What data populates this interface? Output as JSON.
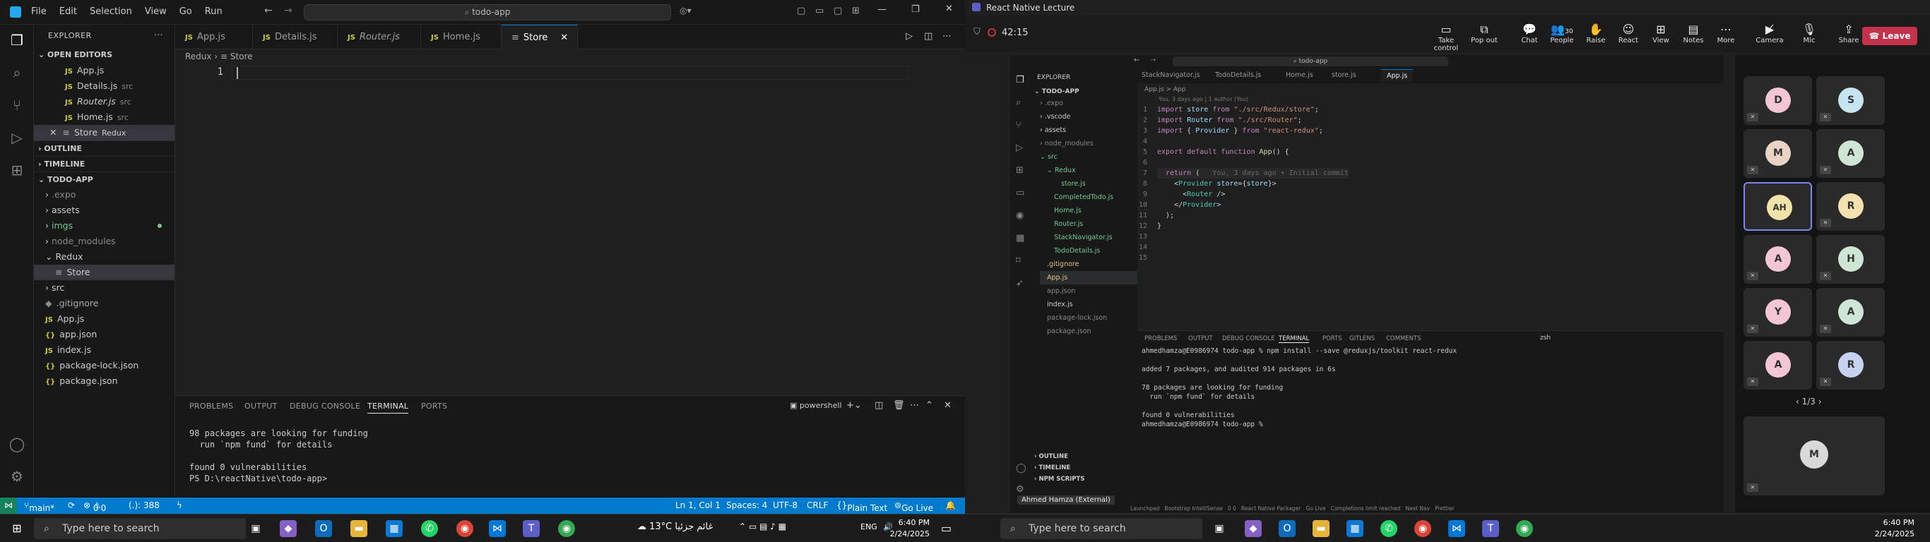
{
  "left": {
    "menu": [
      "File",
      "Edit",
      "Selection",
      "View",
      "Go",
      "Run"
    ],
    "command_center": "todo-app",
    "explorer_title": "EXPLORER",
    "open_editors_label": "OPEN EDITORS",
    "open_editors": [
      {
        "name": "App.js",
        "sub": ""
      },
      {
        "name": "Details.js",
        "sub": "src"
      },
      {
        "name": "Router.js",
        "sub": "src"
      },
      {
        "name": "Home.js",
        "sub": "src"
      },
      {
        "name": "Store",
        "sub": "Redux"
      }
    ],
    "outline_label": "OUTLINE",
    "timeline_label": "TIMELINE",
    "project_label": "TODO-APP",
    "tree": [
      ".expo",
      "assets",
      "imgs",
      "node_modules",
      "Redux",
      "Store",
      "src",
      ".gitignore",
      "App.js",
      "app.json",
      "index.js",
      "package-lock.json",
      "package.json"
    ],
    "tabs": [
      "App.js",
      "Details.js",
      "Router.js",
      "Home.js",
      "Store"
    ],
    "breadcrumb": [
      "Redux",
      "Store"
    ],
    "line_number": "1",
    "panel_tabs": [
      "PROBLEMS",
      "OUTPUT",
      "DEBUG CONSOLE",
      "TERMINAL",
      "PORTS"
    ],
    "shell": "powershell",
    "terminal_text": "98 packages are looking for funding\n  run `npm fund` for details\n\nfound 0 vulnerabilities\nPS D:\\reactNative\\todo-app> ",
    "status": {
      "branch": "main*",
      "errors": "0",
      "warnings": "0",
      "extra": "(.): 388",
      "position": "Ln 1, Col 1",
      "spaces": "Spaces: 4",
      "encoding": "UTF-8",
      "eol": "CRLF",
      "language": "Plain Text",
      "golive": "Go Live"
    }
  },
  "teams": {
    "window_title": "React Native Lecture",
    "timer": "42:15",
    "buttons": [
      "Take control",
      "Pop out",
      "Chat",
      "People",
      "Raise",
      "React",
      "View",
      "Notes",
      "More",
      "Camera",
      "Mic",
      "Share"
    ],
    "people_count": "30",
    "leave_label": "Leave",
    "participants": [
      "D",
      "S",
      "M",
      "A",
      "AH",
      "R",
      "A",
      "H",
      "Y",
      "A",
      "A",
      "R"
    ],
    "pagination": "1/3",
    "bottom_participant": "M",
    "presenter_label": "Ahmed Hamza (External)",
    "inner": {
      "command": "todo-app",
      "explorer": "EXPLORER",
      "project": "TODO-APP",
      "tree": [
        ".expo",
        ".vscode",
        "assets",
        "node_modules",
        "src",
        "Redux",
        "store.js",
        "CompletedTodo.js",
        "Home.js",
        "Router.js",
        "StackNavigator.js",
        "TodoDetails.js",
        ".gitignore",
        "App.js",
        "app.json",
        "index.js",
        "package-lock.json",
        "package.json"
      ],
      "outline": "OUTLINE",
      "timeline": "TIMELINE",
      "npm_scripts": "NPM SCRIPTS",
      "tabs": [
        "StackNavigator.js",
        "TodoDetails.js",
        "Home.js",
        "store.js",
        "App.js"
      ],
      "breadcrumb": "App.js > App",
      "blame": "You, 3 days ago | 1 author (You)",
      "code": [
        "import store from \"./src/Redux/store\";",
        "import Router from \"./src/Router\";",
        "import { Provider } from \"react-redux\";",
        "",
        "export default function App() {",
        "",
        "  return (",
        "    <Provider store={store}>",
        "      <Router />",
        "    </Provider>",
        "  );",
        "}",
        "",
        "",
        ""
      ],
      "inline_blame": "You, 3 days ago • Initial commit",
      "panel_tabs": [
        "PROBLEMS",
        "OUTPUT",
        "DEBUG CONSOLE",
        "TERMINAL",
        "PORTS",
        "GITLENS",
        "COMMENTS"
      ],
      "shell": "zsh",
      "terminal": "ahmedhamza@E0986974 todo-app % npm install --save @reduxjs/toolkit react-redux\n\nadded 7 packages, and audited 914 packages in 6s\n\n78 packages are looking for funding\n  run `npm fund` for details\n\nfound 0 vulnerabilities\nahmedhamza@E0986974 todo-app % ",
      "status": "Launchpad   Bootstrap IntelliSense   0 0   React Native Packager   Go Live   Completions limit reached   Next Nav   Prettier"
    }
  },
  "taskbar": {
    "search_placeholder": "Type here to search",
    "weather_temp": "13°C",
    "weather_text": "غائم جزئيا",
    "lang": "ENG",
    "time": "6:40 PM",
    "date": "2/24/2025",
    "search_placeholder_2": "Type here to search",
    "time_2": "6:40 PM",
    "date_2": "2/24/2025"
  },
  "colors": {
    "accent": "#007acc",
    "leave": "#c4314b",
    "active_speaker": "#7f85f5"
  }
}
